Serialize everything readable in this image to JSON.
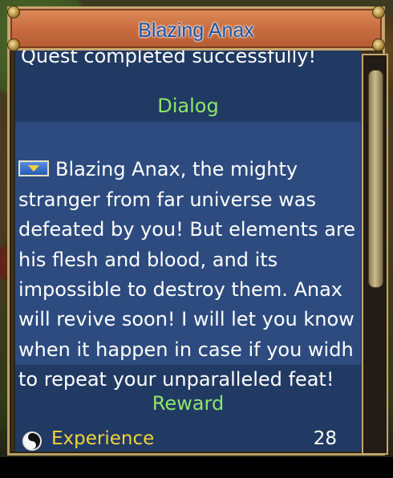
{
  "window": {
    "title": "Blazing Anax"
  },
  "quest": {
    "status": "Quest completed successfully!"
  },
  "dialog": {
    "heading": "Dialog",
    "text": "Blazing Anax, the mighty\nstranger from far universe was\ndefeated by you! But elements are\nhis flesh and blood, and its\nimpossible to destroy them. Anax\nwill revive soon! I will let you know\nwhen it happen in case if you widh\nto repeat your unparalleled feat!"
  },
  "reward": {
    "heading": "Reward",
    "experience_label": "Experience",
    "experience_value": "28"
  },
  "icons": {
    "dialog_icon": "speech-icon",
    "experience_icon": "yin-yang-icon"
  },
  "colors": {
    "title_text": "#1b4f9e",
    "section_heading": "#8de76a",
    "panel_blue": "#213a63",
    "dialog_blue": "#2d4b7f",
    "reward_label": "#f3d33a"
  }
}
